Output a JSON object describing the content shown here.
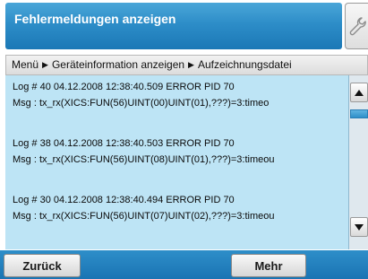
{
  "title": "Fehlermeldungen anzeigen",
  "header_icon": "wrench-icon",
  "breadcrumb": {
    "items": [
      "Menü",
      "Geräteinformation anzeigen",
      "Aufzeichnungsdatei"
    ],
    "separator": "▶"
  },
  "log_entries": [
    {
      "header": "Log # 40  04.12.2008  12:38:40.509  ERROR  PID  70",
      "message": "Msg : tx_rx(XICS:FUN(56)UINT(00)UINT(01),???)=3:timeo"
    },
    {
      "header": "Log # 38  04.12.2008  12:38:40.503  ERROR  PID  70",
      "message": "Msg : tx_rx(XICS:FUN(56)UINT(08)UINT(01),???)=3:timeou"
    },
    {
      "header": "Log # 30  04.12.2008  12:38:40.494  ERROR  PID  70",
      "message": "Msg : tx_rx(XICS:FUN(56)UINT(07)UINT(02),???)=3:timeou"
    }
  ],
  "scrollbar": {
    "up_icon": "arrow-up-icon",
    "down_icon": "arrow-down-icon"
  },
  "footer": {
    "back_label": "Zurück",
    "more_label": "Mehr"
  },
  "colors": {
    "title_blue": "#2d8dc8",
    "panel_light_blue": "#bde4f5",
    "footer_blue": "#1a74b3"
  }
}
